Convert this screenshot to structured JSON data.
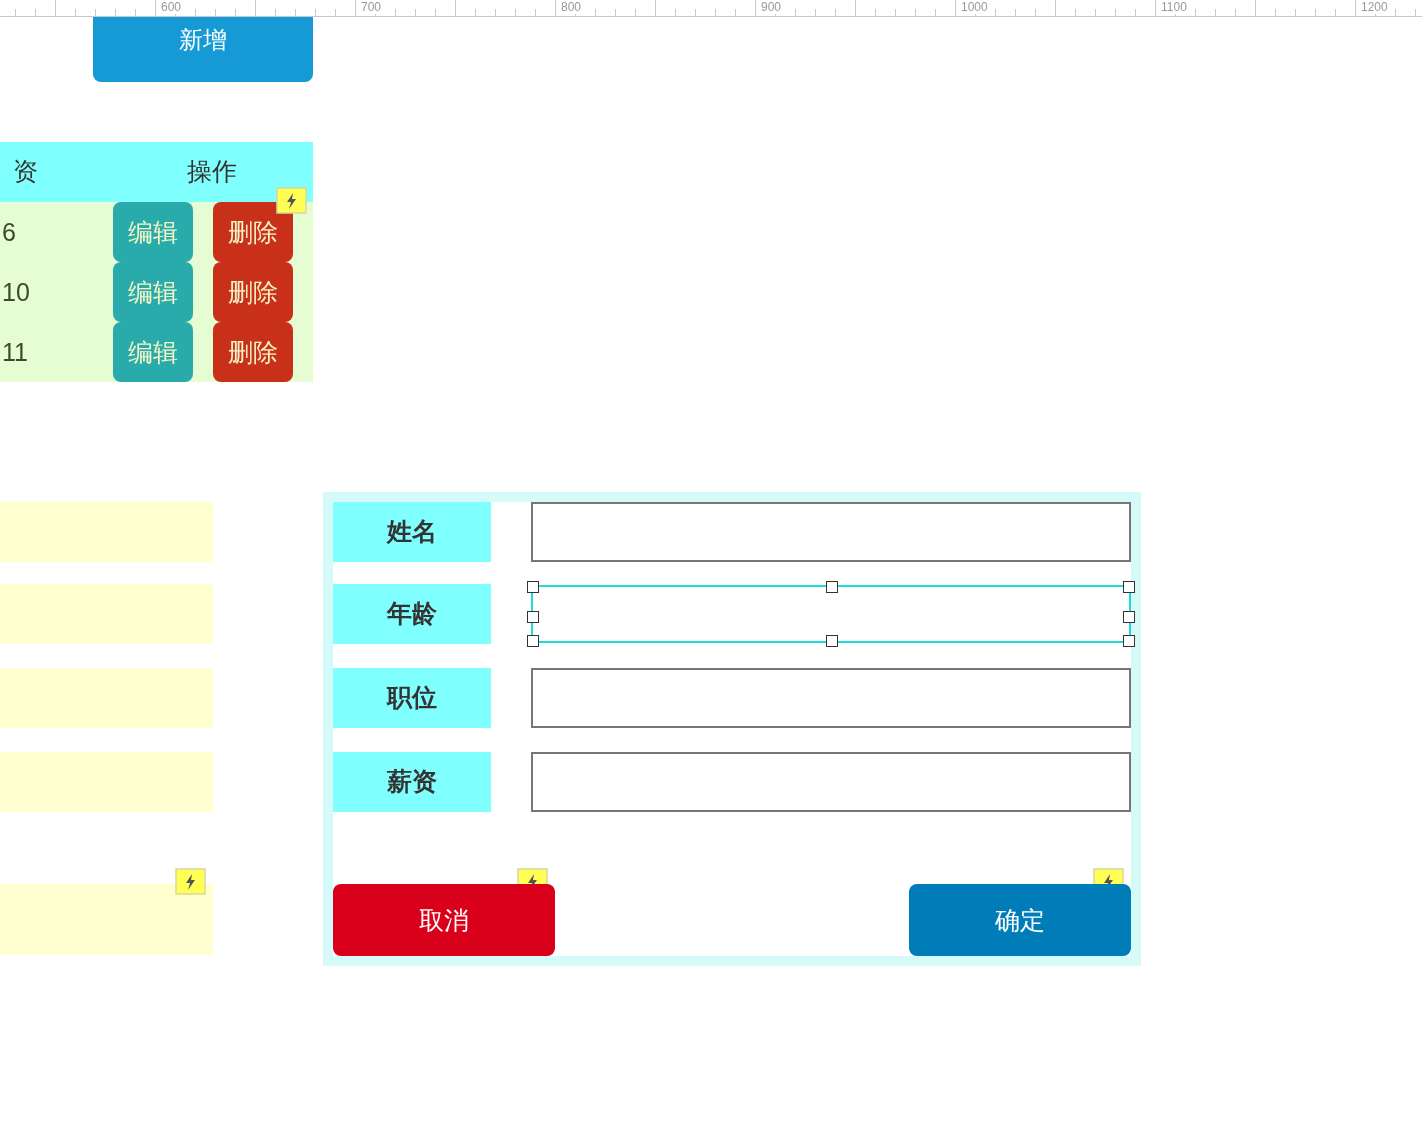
{
  "ruler": {
    "labels": [
      "600",
      "700",
      "800",
      "900",
      "1000",
      "1100",
      "1200"
    ]
  },
  "add_button": "新增",
  "table": {
    "columns": [
      "资",
      "操作"
    ],
    "rows": [
      {
        "value": "6",
        "edit": "编辑",
        "delete": "删除"
      },
      {
        "value": "10",
        "edit": "编辑",
        "delete": "删除"
      },
      {
        "value": "11",
        "edit": "编辑",
        "delete": "删除"
      }
    ]
  },
  "left_panels": [
    {
      "kind": "field"
    },
    {
      "kind": "field"
    },
    {
      "kind": "field"
    },
    {
      "kind": "field"
    },
    {
      "kind": "tall"
    }
  ],
  "form": {
    "fields": [
      {
        "label": "姓名",
        "selected": false
      },
      {
        "label": "年龄",
        "selected": true
      },
      {
        "label": "职位",
        "selected": false
      },
      {
        "label": "薪资",
        "selected": false
      }
    ],
    "cancel": "取消",
    "confirm": "确定"
  }
}
